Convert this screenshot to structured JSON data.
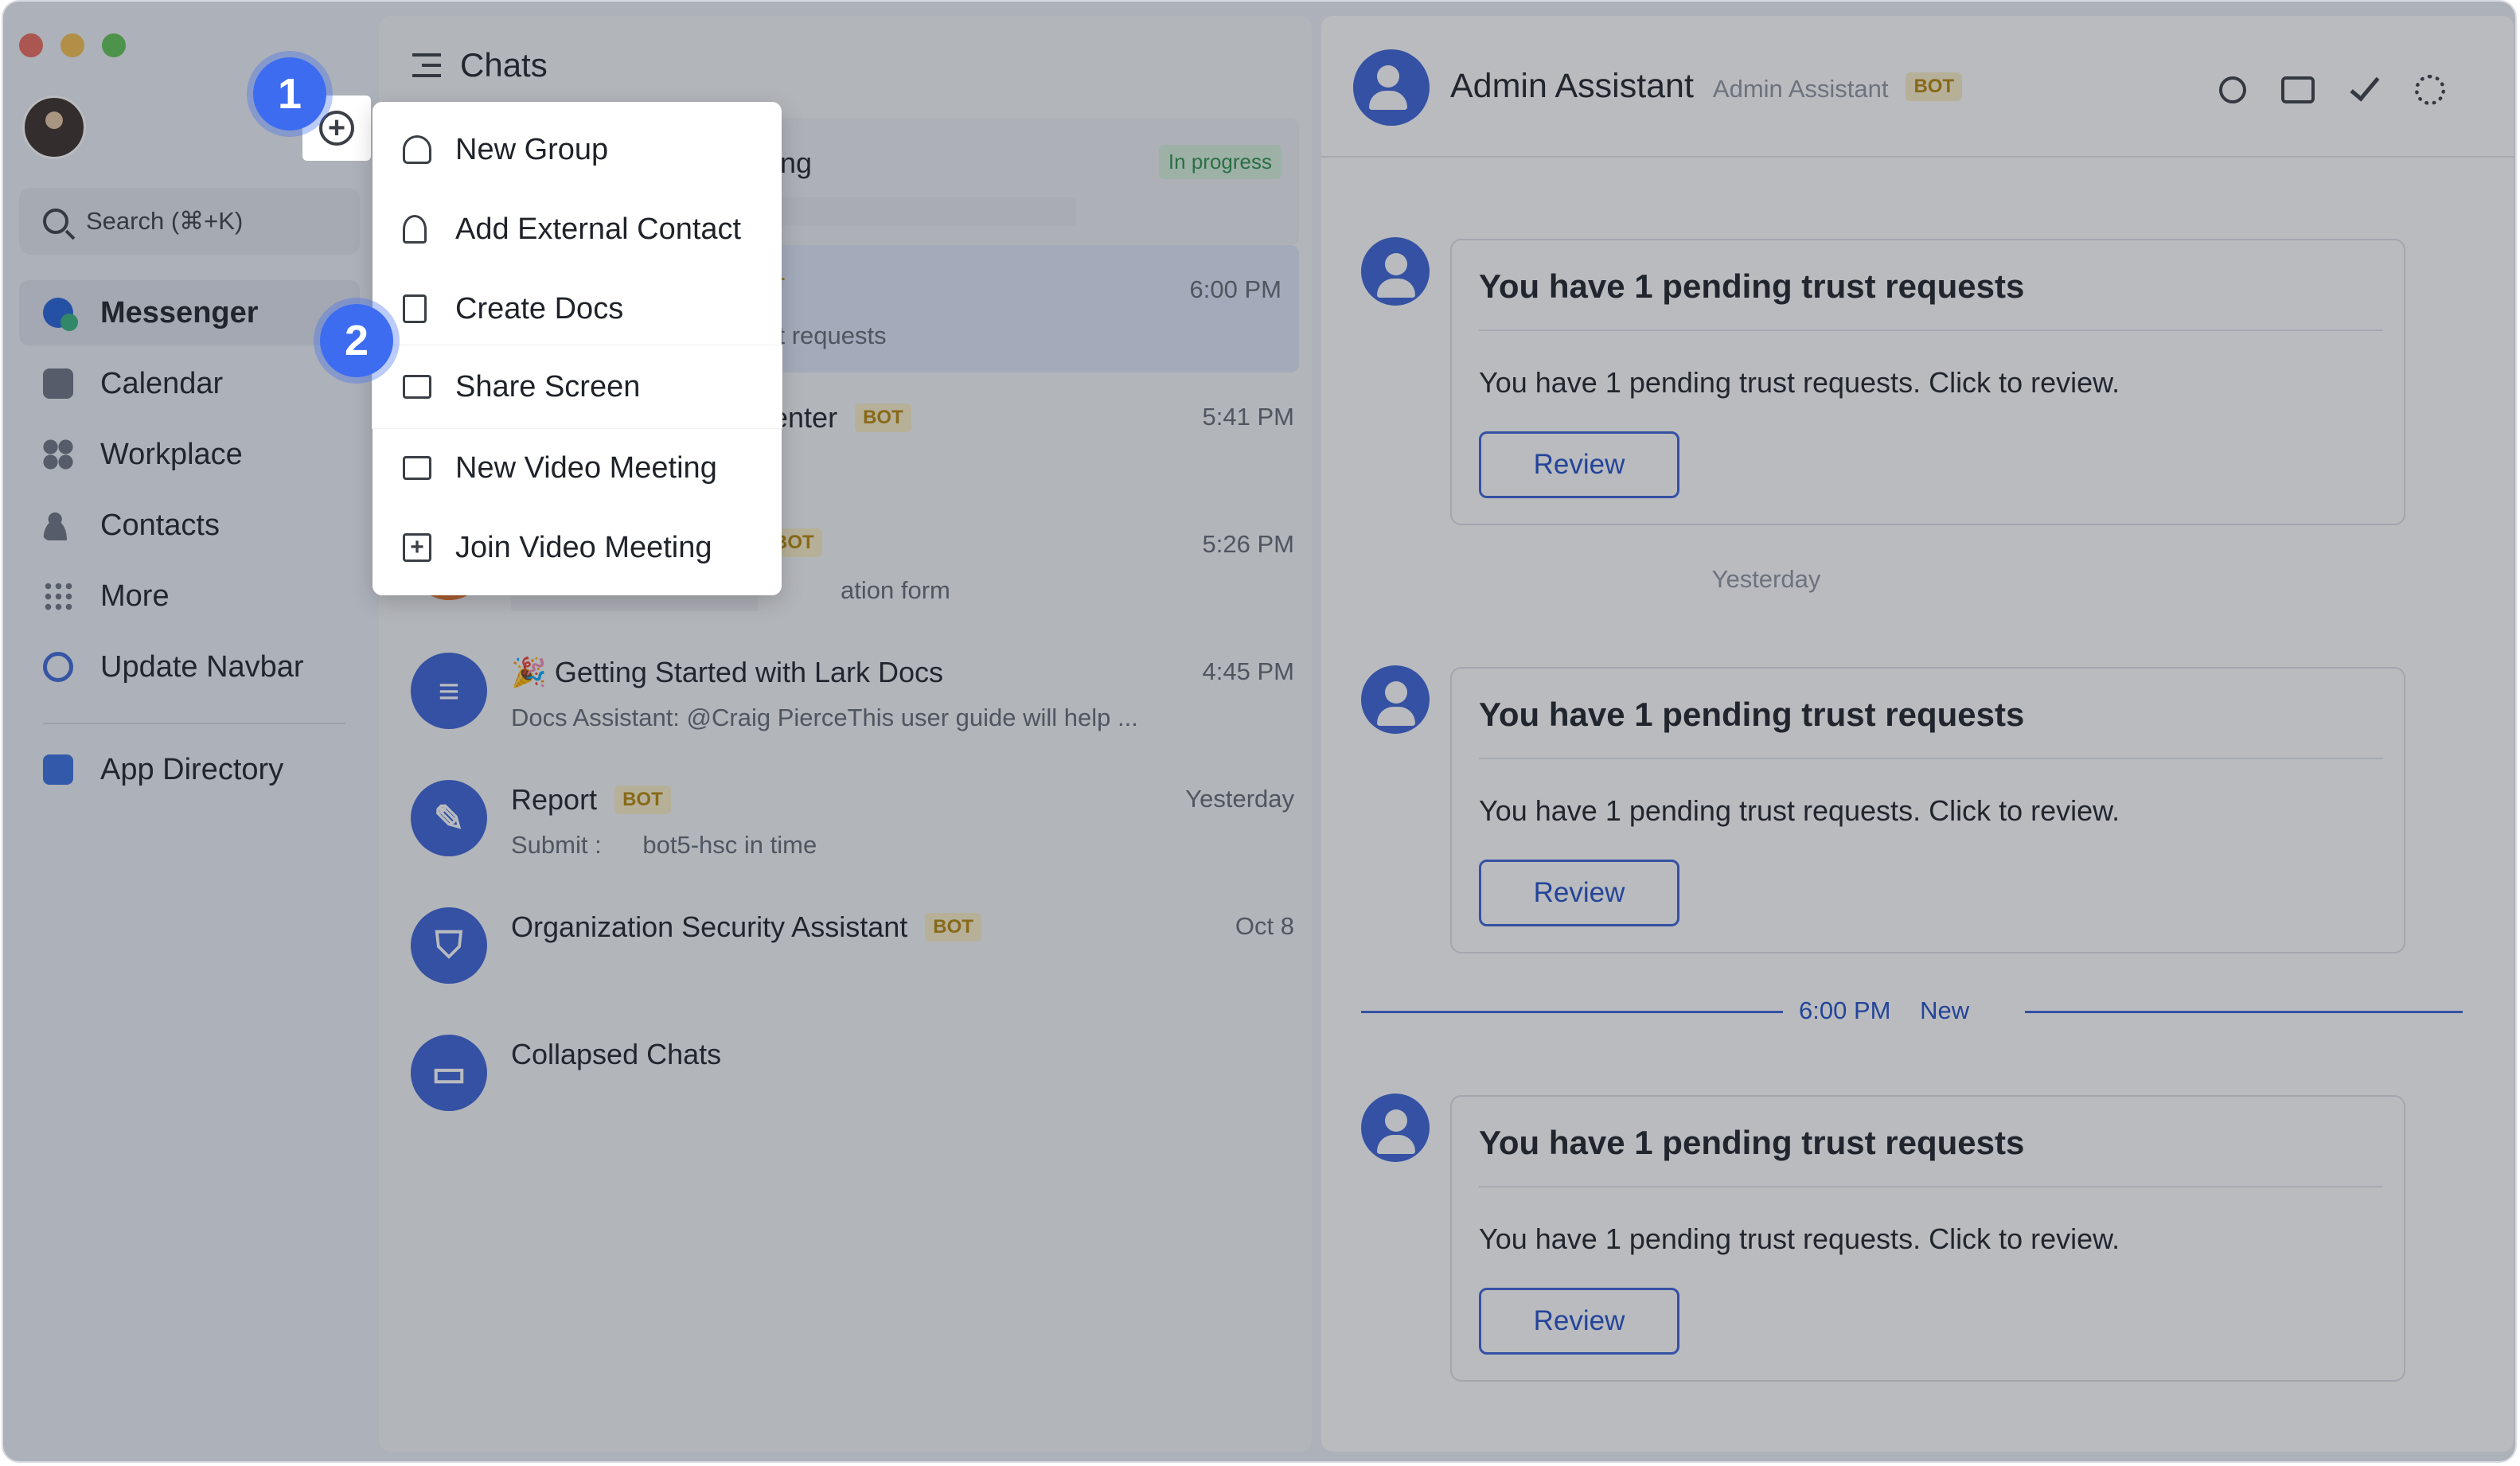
{
  "sidebar": {
    "search_placeholder": "Search (⌘+K)",
    "items": [
      {
        "label": "Messenger",
        "icon": "messenger-icon"
      },
      {
        "label": "Calendar",
        "icon": "calendar-icon"
      },
      {
        "label": "Workplace",
        "icon": "workplace-icon"
      },
      {
        "label": "Contacts",
        "icon": "contacts-icon"
      },
      {
        "label": "More",
        "icon": "more-icon"
      },
      {
        "label": "Update Navbar",
        "icon": "update-icon"
      },
      {
        "label": "App Directory",
        "icon": "app-directory-icon"
      }
    ]
  },
  "chatlist": {
    "title": "Chats",
    "chats": [
      {
        "name_fragment": "eting",
        "status": "In progress",
        "sub_fragment": "sg"
      },
      {
        "name_fragment": "T",
        "time": "6:00 PM",
        "sub_fragment": "st requests"
      },
      {
        "name_fragment": "enter",
        "badge": "BOT",
        "time": "5:41 PM"
      },
      {
        "badge": "BOT",
        "time": "5:26 PM",
        "sub_fragment": "ation form"
      },
      {
        "name": "🎉 Getting Started with Lark Docs",
        "time": "4:45 PM",
        "sub": "Docs Assistant: @Craig PierceThis user guide will help ..."
      },
      {
        "name": "Report",
        "badge": "BOT",
        "time": "Yesterday",
        "sub": "Submit :      bot5-hsc in time"
      },
      {
        "name": "Organization Security Assistant",
        "badge": "BOT",
        "time": "Oct 8"
      },
      {
        "name": "Collapsed Chats"
      }
    ]
  },
  "menu": {
    "items": [
      {
        "label": "New Group",
        "icon": "group-icon"
      },
      {
        "label": "Add External Contact",
        "icon": "add-contact-icon"
      },
      {
        "label": "Create Docs",
        "icon": "create-docs-icon"
      },
      {
        "label": "Share Screen",
        "icon": "share-screen-icon"
      },
      {
        "label": "New Video Meeting",
        "icon": "video-icon"
      },
      {
        "label": "Join Video Meeting",
        "icon": "join-icon"
      }
    ]
  },
  "conversation": {
    "title": "Admin Assistant",
    "subtitle": "Admin Assistant",
    "badge": "BOT",
    "messages": [
      {
        "title": "You have 1 pending trust requests",
        "body": "You have 1 pending trust requests. Click to review.",
        "button": "Review"
      },
      {
        "title": "You have 1 pending trust requests",
        "body": "You have 1 pending trust requests. Click to review.",
        "button": "Review"
      },
      {
        "title": "You have 1 pending trust requests",
        "body": "You have 1 pending trust requests. Click to review.",
        "button": "Review"
      }
    ],
    "day_separator": "Yesterday",
    "new_divider": {
      "time": "6:00 PM",
      "label": "New"
    }
  },
  "callouts": [
    "1",
    "2"
  ]
}
